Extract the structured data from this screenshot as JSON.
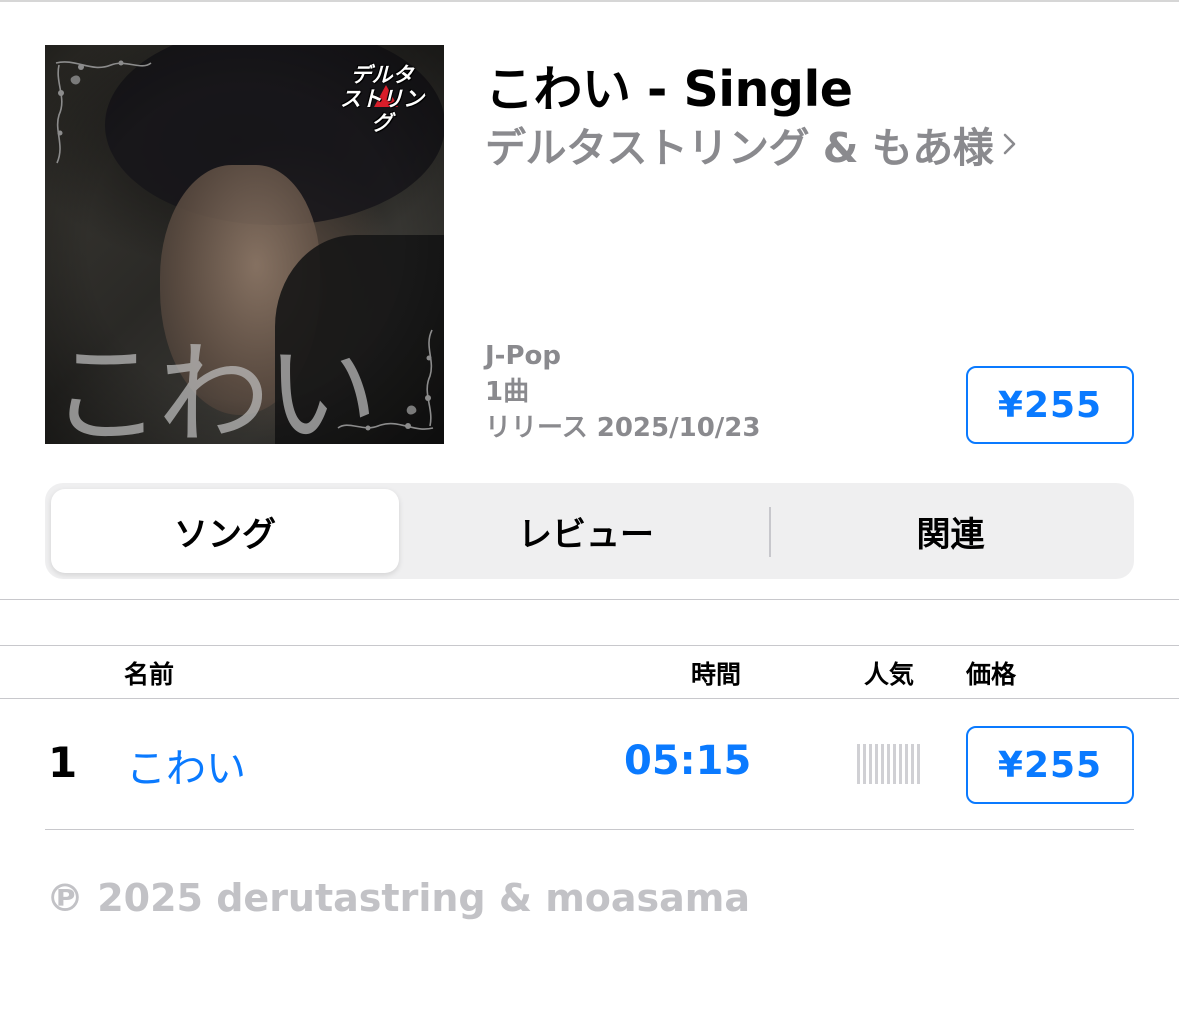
{
  "album": {
    "title": "こわい - Single",
    "artist": "デルタストリング & もあ様",
    "genre": "J-Pop",
    "track_count": "1曲",
    "release": "リリース 2025/10/23",
    "price": "¥255"
  },
  "artwork": {
    "logo_line1": "デルタ",
    "logo_line2": "ストリング",
    "overlay_title": "こわい"
  },
  "tabs": [
    "ソング",
    "レビュー",
    "関連"
  ],
  "selected_tab": "ソング",
  "table": {
    "headers": {
      "name": "名前",
      "time": "時間",
      "popularity": "人気",
      "price": "価格"
    },
    "tracks": [
      {
        "number": "1",
        "title": "こわい",
        "duration": "05:15",
        "price": "¥255",
        "popularity": 0
      }
    ]
  },
  "copyright": "℗ 2025 derutastring & moasama",
  "colors": {
    "accent": "#0a7aff",
    "secondary_text": "#8a8a8e",
    "muted_text": "#c2c2c6"
  }
}
